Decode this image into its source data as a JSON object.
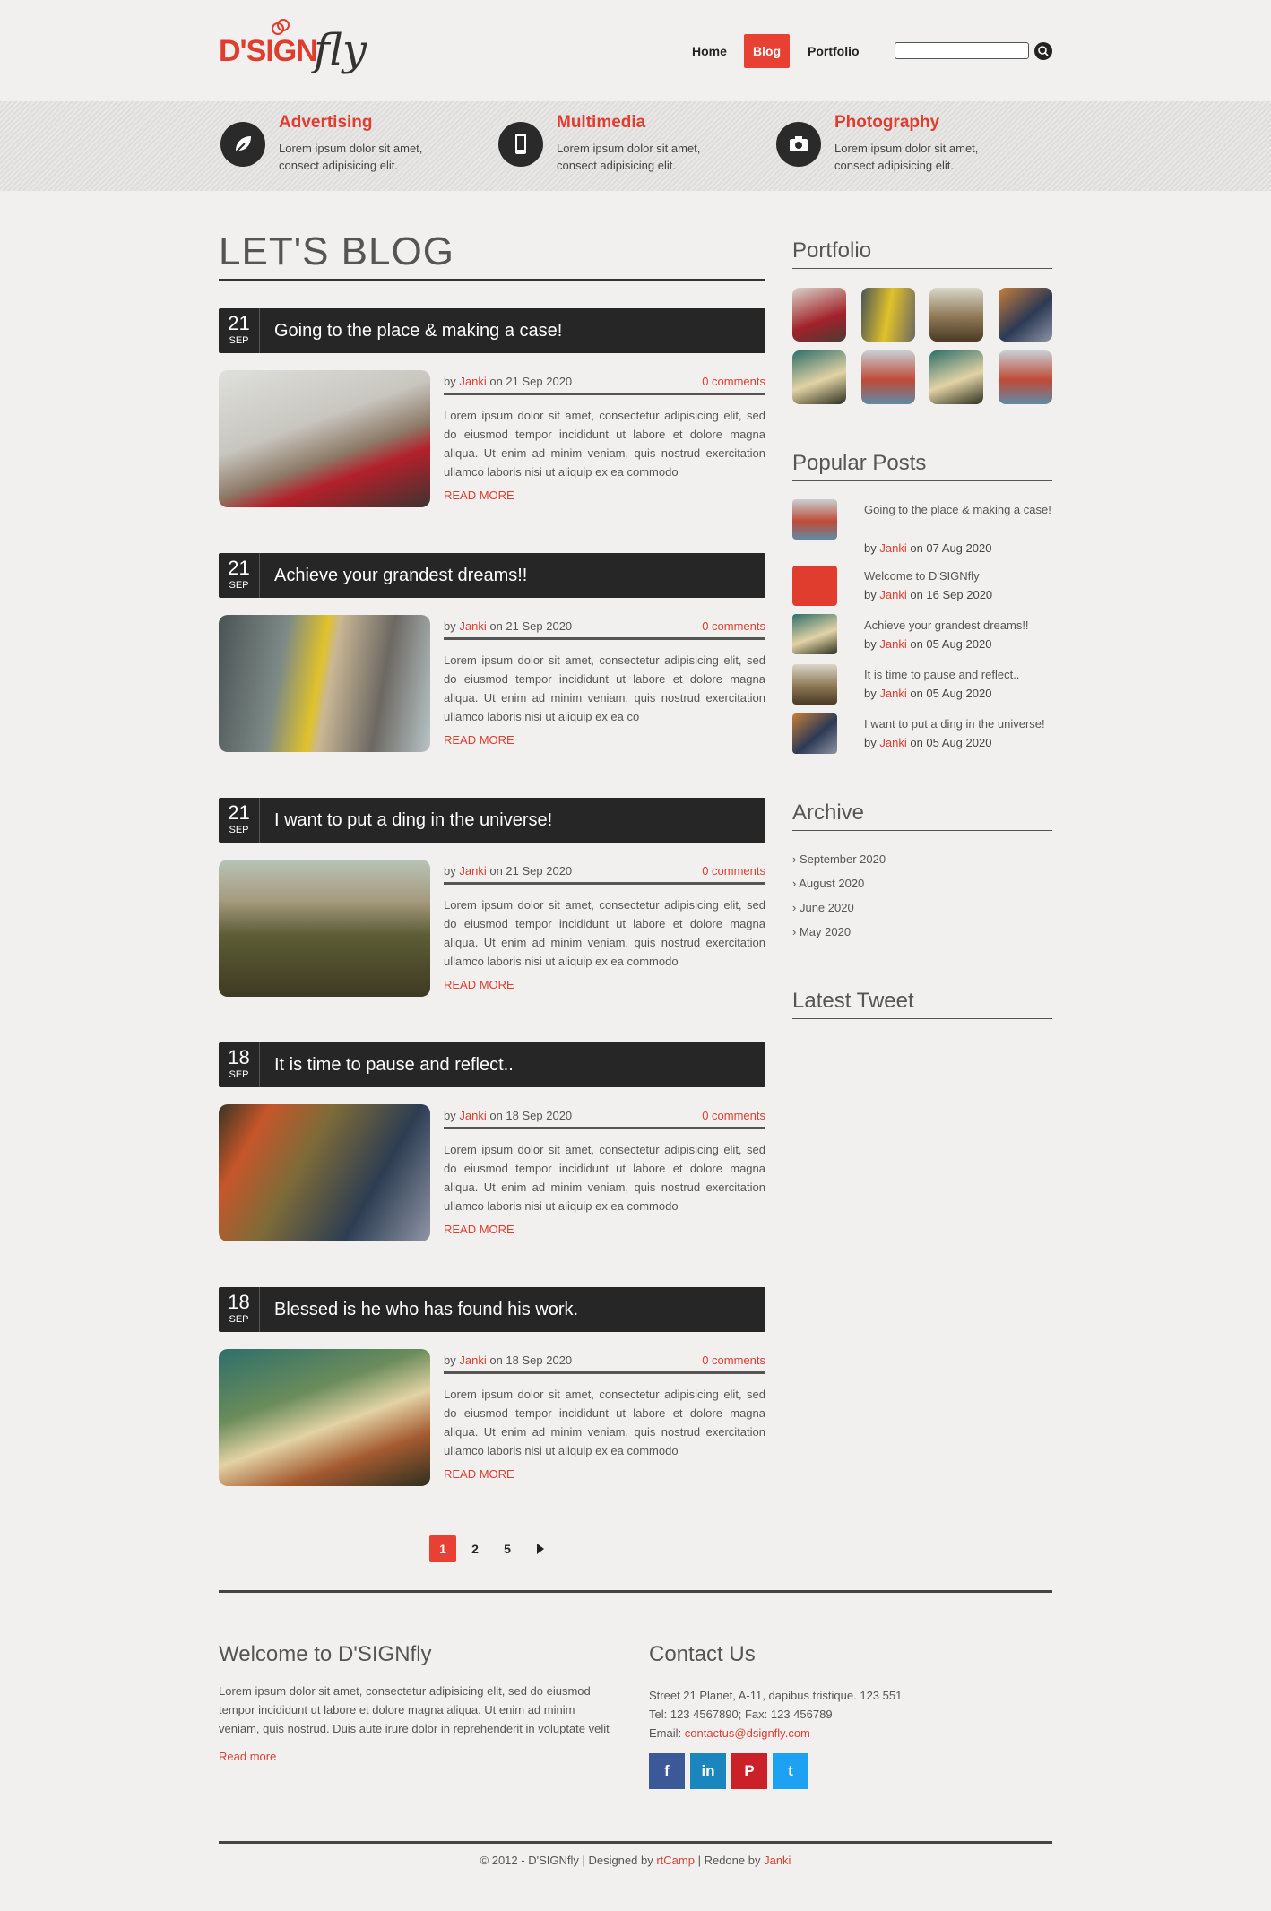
{
  "header": {
    "logo_main": "D'SIGN",
    "logo_script": "fly",
    "nav": [
      "Home",
      "Blog",
      "Portfolio"
    ],
    "search_placeholder": ""
  },
  "services": [
    {
      "title": "Advertising",
      "text": "Lorem ipsum dolor sit amet, consect adipisicing elit.",
      "icon": "leaf-icon"
    },
    {
      "title": "Multimedia",
      "text": "Lorem ipsum dolor sit amet, consect adipisicing elit.",
      "icon": "mobile-icon"
    },
    {
      "title": "Photography",
      "text": "Lorem ipsum dolor sit amet, consect adipisicing elit.",
      "icon": "camera-icon"
    }
  ],
  "main": {
    "title": "LET'S BLOG",
    "posts": [
      {
        "day": "21",
        "month": "SEP",
        "title": "Going to the place & making a case!",
        "by": "by",
        "author": "Janki",
        "on": "on 21 Sep 2020",
        "comments": "0 comments",
        "excerpt": "Lorem ipsum dolor sit amet, consectetur adipisicing elit, sed do eiusmod tempor incididunt ut labore et dolore magna aliqua. Ut enim ad minim veniam, quis nostrud exercitation ullamco laboris nisi ut aliquip ex ea commodo",
        "read_more": "READ MORE"
      },
      {
        "day": "21",
        "month": "SEP",
        "title": "Achieve your grandest dreams!!",
        "by": "by",
        "author": "Janki",
        "on": "on 21 Sep 2020",
        "comments": "0 comments",
        "excerpt": "Lorem ipsum dolor sit amet, consectetur adipisicing elit, sed do eiusmod tempor incididunt ut labore et dolore magna aliqua. Ut enim ad minim veniam, quis nostrud exercitation ullamco laboris nisi ut aliquip ex ea co",
        "read_more": "READ MORE"
      },
      {
        "day": "21",
        "month": "SEP",
        "title": "I want to put a ding in the universe!",
        "by": "by",
        "author": "Janki",
        "on": "on 21 Sep 2020",
        "comments": "0 comments",
        "excerpt": "Lorem ipsum dolor sit amet, consectetur adipisicing elit, sed do eiusmod tempor incididunt ut labore et dolore magna aliqua. Ut enim ad minim veniam, quis nostrud exercitation ullamco laboris nisi ut aliquip ex ea commodo",
        "read_more": "READ MORE"
      },
      {
        "day": "18",
        "month": "SEP",
        "title": "It is time to pause and reflect..",
        "by": "by",
        "author": "Janki",
        "on": "on 18 Sep 2020",
        "comments": "0 comments",
        "excerpt": "Lorem ipsum dolor sit amet, consectetur adipisicing elit, sed do eiusmod tempor incididunt ut labore et dolore magna aliqua. Ut enim ad minim veniam, quis nostrud exercitation ullamco laboris nisi ut aliquip ex ea commodo",
        "read_more": "READ MORE"
      },
      {
        "day": "18",
        "month": "SEP",
        "title": "Blessed is he who has found his work.",
        "by": "by",
        "author": "Janki",
        "on": "on 18 Sep 2020",
        "comments": "0 comments",
        "excerpt": "Lorem ipsum dolor sit amet, consectetur adipisicing elit, sed do eiusmod tempor incididunt ut labore et dolore magna aliqua. Ut enim ad minim veniam, quis nostrud exercitation ullamco laboris nisi ut aliquip ex ea commodo",
        "read_more": "READ MORE"
      }
    ],
    "pagination": [
      "1",
      "2",
      "5"
    ],
    "next_icon": "triangle-right-icon"
  },
  "sidebar": {
    "portfolio_title": "Portfolio",
    "popular_title": "Popular Posts",
    "popular": [
      {
        "title": "Going to the place & making a case!",
        "by": "by",
        "author": "Janki",
        "on": "on 07 Aug 2020"
      },
      {
        "title": "Welcome to D'SIGNfly",
        "by": "by",
        "author": "Janki",
        "on": "on 16 Sep 2020"
      },
      {
        "title": "Achieve your grandest dreams!!",
        "by": "by",
        "author": "Janki",
        "on": "on 05 Aug 2020"
      },
      {
        "title": "It is time to pause and reflect..",
        "by": "by",
        "author": "Janki",
        "on": "on 05 Aug 2020"
      },
      {
        "title": "I want to put a ding in the universe!",
        "by": "by",
        "author": "Janki",
        "on": "on 05 Aug 2020"
      }
    ],
    "archive_title": "Archive",
    "archive": [
      "September 2020",
      "August 2020",
      "June 2020",
      "May 2020"
    ],
    "tweet_title": "Latest Tweet"
  },
  "footer": {
    "welcome_title": "Welcome to D'SIGNfly",
    "welcome_text": "Lorem ipsum dolor sit amet, consectetur adipisicing elit, sed do eiusmod tempor incididunt ut labore et dolore magna aliqua. Ut enim ad minim veniam, quis nostrud. Duis aute irure dolor in reprehenderit in voluptate velit",
    "read_more": "Read more",
    "contact_title": "Contact Us",
    "address": "Street 21 Planet, A-11, dapibus tristique. 123 551",
    "phone": "Tel: 123 4567890; Fax: 123 456789",
    "email_label": "Email:",
    "email": "contactus@dsignfly.com",
    "social": [
      {
        "label": "f",
        "icon": "facebook-icon",
        "color": "#3b5998"
      },
      {
        "label": "in",
        "icon": "linkedin-icon",
        "color": "#1b86bd"
      },
      {
        "label": "P",
        "icon": "pinterest-icon",
        "color": "#cb2027"
      },
      {
        "label": "t",
        "icon": "twitter-icon",
        "color": "#1da1f2"
      }
    ],
    "copy_prefix": "© 2012 - D'SIGNfly | Designed by",
    "copy_designer": "rtCamp",
    "copy_mid": "| Redone by",
    "copy_redo": "Janki"
  },
  "colors": {
    "accent": "#e84133",
    "dark_bar": "#262626"
  }
}
